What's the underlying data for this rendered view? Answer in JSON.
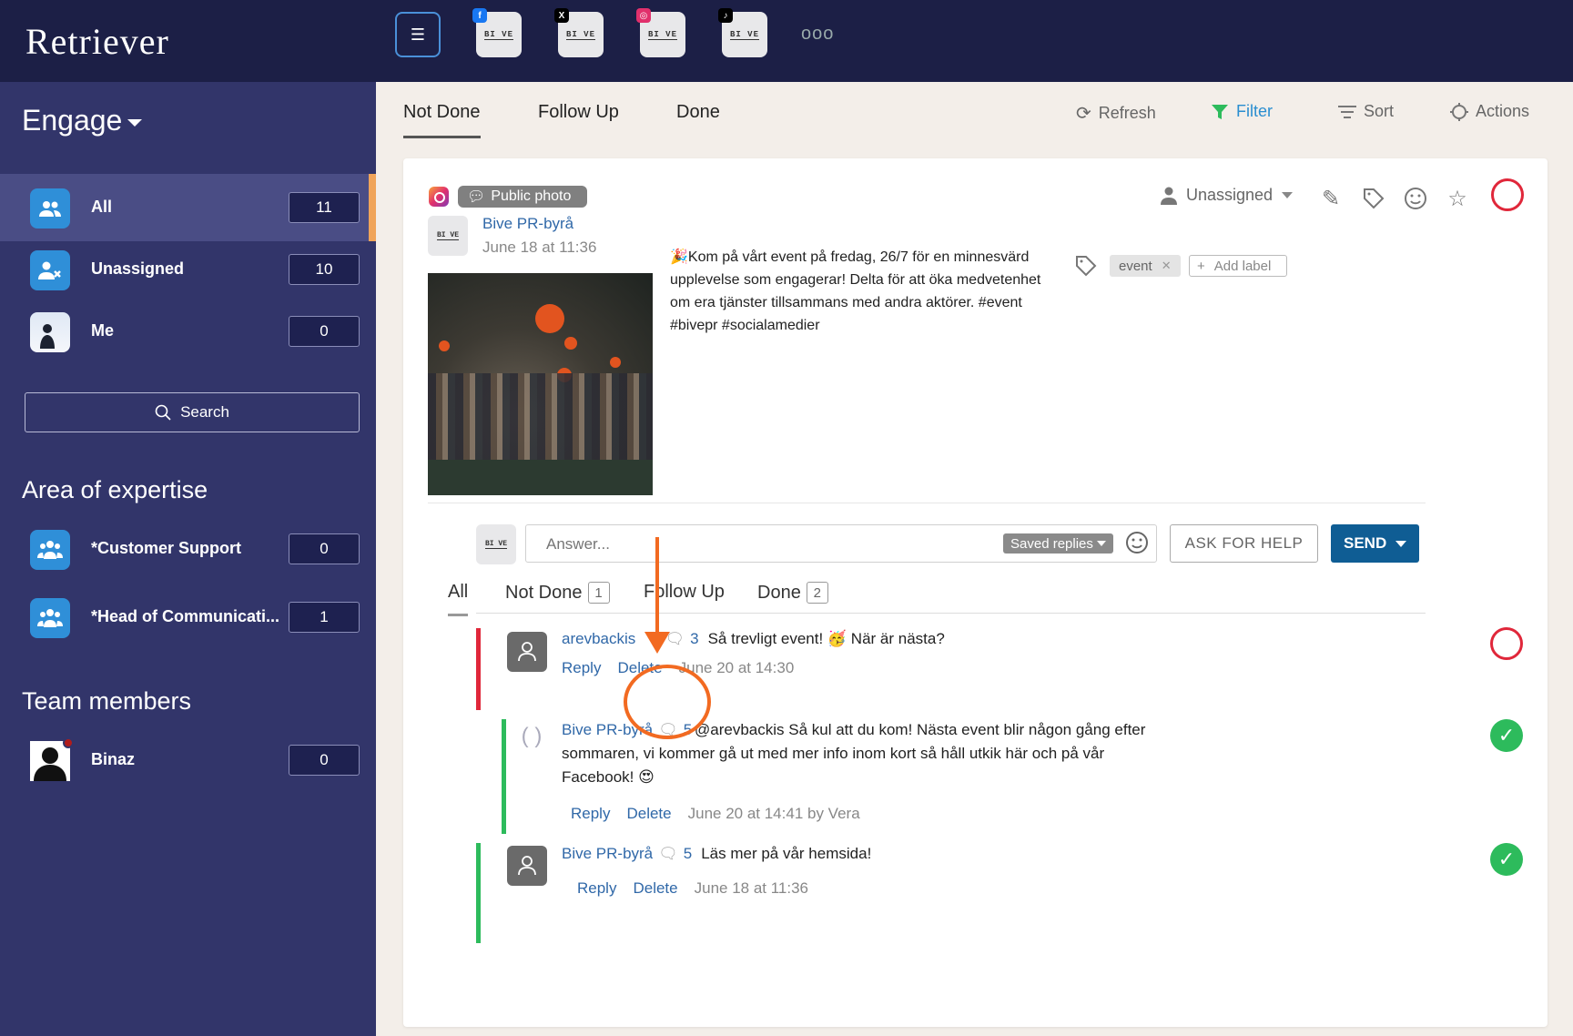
{
  "app": {
    "logo": "Retriever"
  },
  "topbar": {
    "more_label": "ooo",
    "accounts": [
      {
        "network": "facebook",
        "badge": "f",
        "label": "BI VE",
        "color": "#1877f2"
      },
      {
        "network": "x",
        "badge": "X",
        "label": "BI VE",
        "color": "#000000"
      },
      {
        "network": "instagram",
        "badge": "◎",
        "label": "BI VE",
        "color": "#e1306c"
      },
      {
        "network": "tiktok",
        "badge": "♪",
        "label": "BI VE",
        "color": "#000000"
      }
    ]
  },
  "sidebar": {
    "title": "Engage",
    "items": [
      {
        "label": "All",
        "count": "11"
      },
      {
        "label": "Unassigned",
        "count": "10"
      },
      {
        "label": "Me",
        "count": "0"
      }
    ],
    "search_label": "Search",
    "areas_title": "Area of expertise",
    "areas": [
      {
        "label": "*Customer Support",
        "count": "0"
      },
      {
        "label": "*Head of Communicati...",
        "count": "1"
      }
    ],
    "team_title": "Team members",
    "team": [
      {
        "label": "Binaz",
        "count": "0"
      }
    ]
  },
  "main": {
    "tabs": [
      "Not Done",
      "Follow Up",
      "Done"
    ],
    "toolbar": {
      "refresh": "Refresh",
      "filter": "Filter",
      "sort": "Sort",
      "actions": "Actions"
    }
  },
  "post": {
    "type_label": "Public photo",
    "author": "Bive PR-byrå",
    "avatar_label": "BI VE",
    "date": "June 18 at 11:36",
    "assignee": "Unassigned",
    "text": "🎉Kom på vårt event på fredag, 26/7 för en minnesvärd upplevelse som engagerar! Delta för att öka medvetenhet om era tjänster tillsammans med andra aktörer. #event #bivepr #socialamedier",
    "tag": "event",
    "add_label": "Add label"
  },
  "composer": {
    "placeholder": "Answer...",
    "saved_replies": "Saved replies",
    "ask_for_help": "ASK FOR HELP",
    "send": "SEND",
    "avatar_label": "BI VE"
  },
  "comment_tabs": [
    {
      "label": "All",
      "count": ""
    },
    {
      "label": "Not Done",
      "count": "1"
    },
    {
      "label": "Follow Up",
      "count": ""
    },
    {
      "label": "Done",
      "count": "2"
    }
  ],
  "comments": [
    {
      "author": "arevbackis",
      "replies": "3",
      "text": "Så trevligt event! 🥳 När är nästa?",
      "reply": "Reply",
      "delete": "Delete",
      "date": "June 20 at 14:30"
    },
    {
      "author": "Bive PR-byrå",
      "replies": "5",
      "text": "@arevbackis Så kul att du kom! Nästa event blir någon gång efter sommaren, vi kommer gå ut med mer info inom kort så håll utkik här och på vår Facebook! 😍",
      "reply": "Reply",
      "delete": "Delete",
      "date": "June 20 at 14:41 by Vera"
    },
    {
      "author": "Bive PR-byrå",
      "replies": "5",
      "text": "Läs mer på vår hemsida!",
      "reply": "Reply",
      "delete": "Delete",
      "date": "June 18 at 11:36"
    }
  ],
  "colors": {
    "accent_blue": "#2a8ed0",
    "send_blue": "#0f5d94",
    "not_done_red": "#e0273a",
    "done_green": "#2dbb5c",
    "annotation_orange": "#f26a21",
    "sidebar_bg": "#32356a",
    "topbar_bg": "#1c1f46"
  }
}
